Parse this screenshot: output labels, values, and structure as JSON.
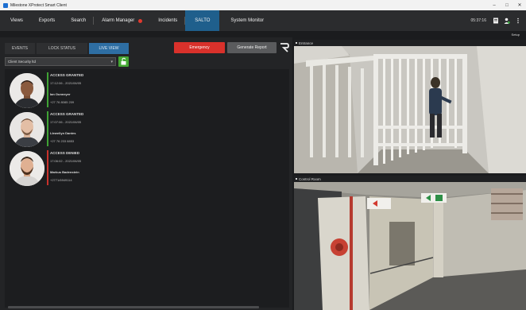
{
  "window": {
    "title": "Milestone XProtect Smart Client",
    "controls": [
      "–",
      "□",
      "✕"
    ]
  },
  "nav": {
    "items": [
      {
        "label": "Views"
      },
      {
        "label": "Exports"
      },
      {
        "label": "Search"
      },
      {
        "label": "Alarm Manager"
      },
      {
        "label": "Incidents"
      },
      {
        "label": "SALTO"
      },
      {
        "label": "System Monitor"
      }
    ],
    "clock": "05:37:16",
    "setup": "Setup"
  },
  "salto": {
    "tabs": [
      "EVENTS",
      "LOCK STATUS",
      "LIVE VIEW"
    ],
    "emergency": "Emergency",
    "generate_report": "Generate Report",
    "door_select": "Client Security ltd",
    "events": [
      {
        "status": "ACCESS GRANTED",
        "time": "17:12:06 - 2021/06/05",
        "name": "Ian Ounneyer",
        "phone": "+27 76 8085 209",
        "status_color": "#3fa334"
      },
      {
        "status": "ACCESS GRANTED",
        "time": "17:07:06 - 2021/06/05",
        "name": "Llewellyn Dantes",
        "phone": "+27 76 233 8853",
        "status_color": "#3fa334"
      },
      {
        "status": "ACCESS DENIED",
        "time": "17:06:02 - 2021/06/05",
        "name": "Markus Badenstein",
        "phone": "+2771/6949114",
        "status_color": "#c9312b"
      }
    ]
  },
  "cameras": [
    {
      "title": "Entrance"
    },
    {
      "title": "Control Room"
    }
  ]
}
